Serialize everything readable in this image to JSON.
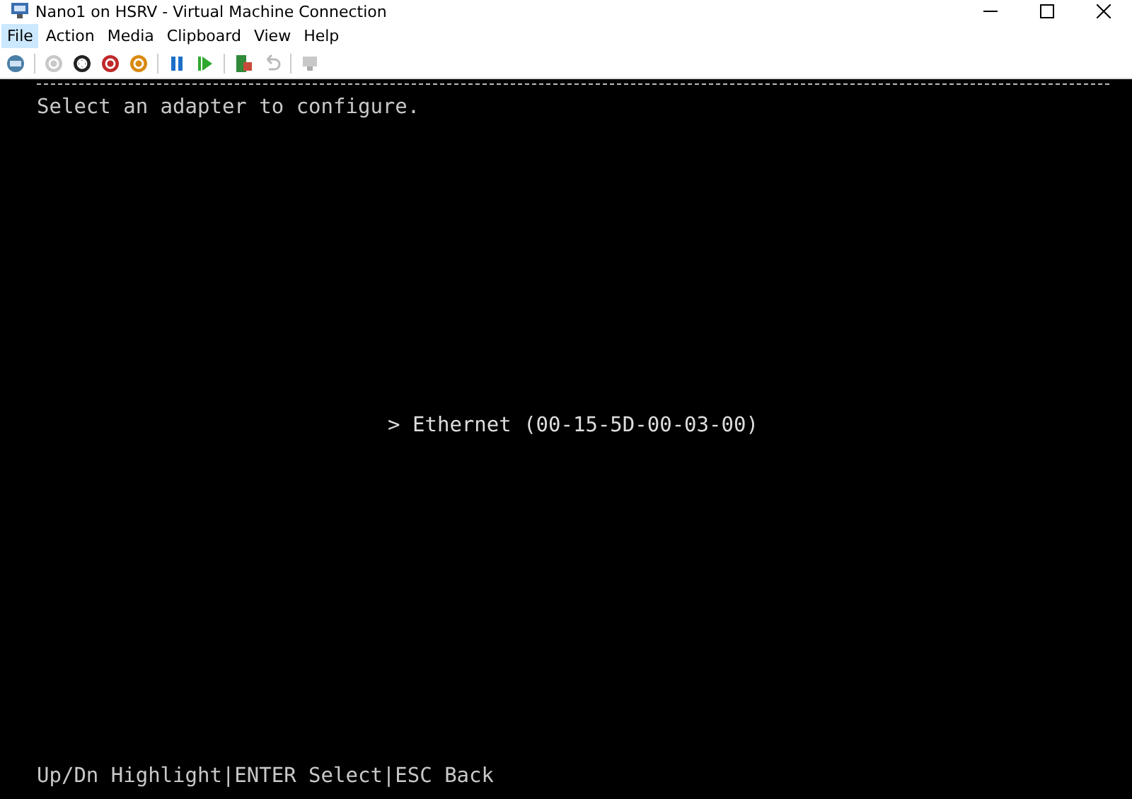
{
  "window": {
    "title": "Nano1 on HSRV - Virtual Machine Connection"
  },
  "menu": [
    {
      "label": "File",
      "selected": true
    },
    {
      "label": "Action",
      "selected": false
    },
    {
      "label": "Media",
      "selected": false
    },
    {
      "label": "Clipboard",
      "selected": false
    },
    {
      "label": "View",
      "selected": false
    },
    {
      "label": "Help",
      "selected": false
    }
  ],
  "toolbar": [
    {
      "kind": "ctrl-alt-del",
      "disabled": false
    },
    {
      "kind": "sep"
    },
    {
      "kind": "start",
      "disabled": true
    },
    {
      "kind": "turn-off",
      "disabled": false
    },
    {
      "kind": "shut-down",
      "disabled": false
    },
    {
      "kind": "save",
      "disabled": false
    },
    {
      "kind": "sep"
    },
    {
      "kind": "pause",
      "disabled": false
    },
    {
      "kind": "resume",
      "disabled": false
    },
    {
      "kind": "sep"
    },
    {
      "kind": "checkpoint",
      "disabled": false
    },
    {
      "kind": "revert",
      "disabled": true
    },
    {
      "kind": "sep"
    },
    {
      "kind": "session",
      "disabled": true
    }
  ],
  "console": {
    "heading": "Select an adapter to configure.",
    "adapters": [
      {
        "marker": ">",
        "label": "Ethernet (00-15-5D-00-03-00)",
        "selected": true
      }
    ],
    "footer": "Up/Dn Highlight|ENTER Select|ESC Back"
  }
}
